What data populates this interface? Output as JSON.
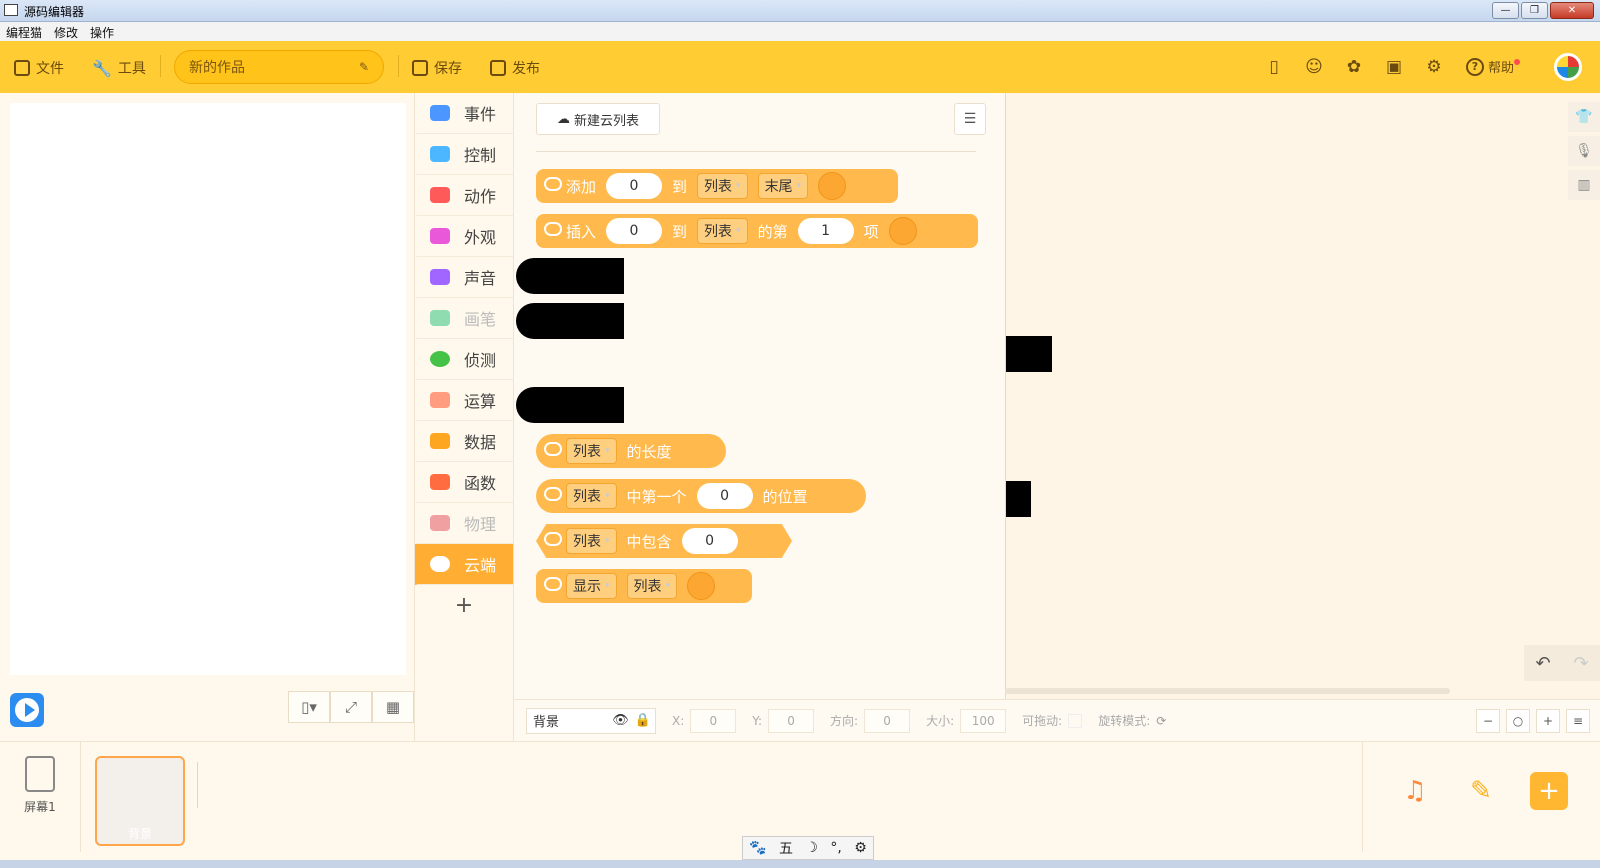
{
  "window": {
    "title": "源码编辑器",
    "buttons": {
      "minimize": "—",
      "maximize": "❐",
      "close": "✕"
    }
  },
  "menu": [
    "编程猫",
    "修改",
    "操作"
  ],
  "toolbar": {
    "file": "文件",
    "tools": "工具",
    "project_name": "新的作品",
    "save": "保存",
    "publish": "发布",
    "help": "帮助"
  },
  "categories": [
    {
      "label": "事件",
      "color": "#4c97ff",
      "dim": false
    },
    {
      "label": "控制",
      "color": "#4cb7ff",
      "dim": false
    },
    {
      "label": "动作",
      "color": "#ff5a5a",
      "dim": false
    },
    {
      "label": "外观",
      "color": "#e858d8",
      "dim": false
    },
    {
      "label": "声音",
      "color": "#a066ff",
      "dim": false
    },
    {
      "label": "画笔",
      "color": "#8edcb0",
      "dim": true
    },
    {
      "label": "侦测",
      "color": "#46c346",
      "dim": false
    },
    {
      "label": "运算",
      "color": "#ff9c80",
      "dim": false
    },
    {
      "label": "数据",
      "color": "#ffa620",
      "dim": false
    },
    {
      "label": "函数",
      "color": "#ff6c40",
      "dim": false
    },
    {
      "label": "物理",
      "color": "#f0a0a0",
      "dim": true
    },
    {
      "label": "云端",
      "color": "#ffffff",
      "dim": false,
      "active": true
    }
  ],
  "blocks_panel": {
    "new_list": "新建云列表",
    "add_block": {
      "verb": "添加",
      "value": "0",
      "to": "到",
      "list": "列表",
      "position": "末尾"
    },
    "insert_block": {
      "verb": "插入",
      "value": "0",
      "to": "到",
      "list": "列表",
      "nth": "的第",
      "index": "1",
      "item": "项"
    },
    "length_block": {
      "list": "列表",
      "text": "的长度"
    },
    "index_block": {
      "list": "列表",
      "text": "中第一个",
      "value": "0",
      "suffix": "的位置"
    },
    "contains_block": {
      "list": "列表",
      "text": "中包含",
      "value": "0"
    },
    "show_block": {
      "verb": "显示",
      "list": "列表"
    }
  },
  "property_bar": {
    "sprite": "背景",
    "x_label": "X:",
    "x": "0",
    "y_label": "Y:",
    "y": "0",
    "dir_label": "方向:",
    "dir": "0",
    "size_label": "大小:",
    "size": "100",
    "draggable_label": "可拖动:",
    "rotation_label": "旋转模式:"
  },
  "bottom": {
    "screen_label": "屏幕1",
    "thumb_label": "背景"
  },
  "ime": [
    "🐾",
    "五",
    "☽",
    "°,",
    "⚙"
  ]
}
